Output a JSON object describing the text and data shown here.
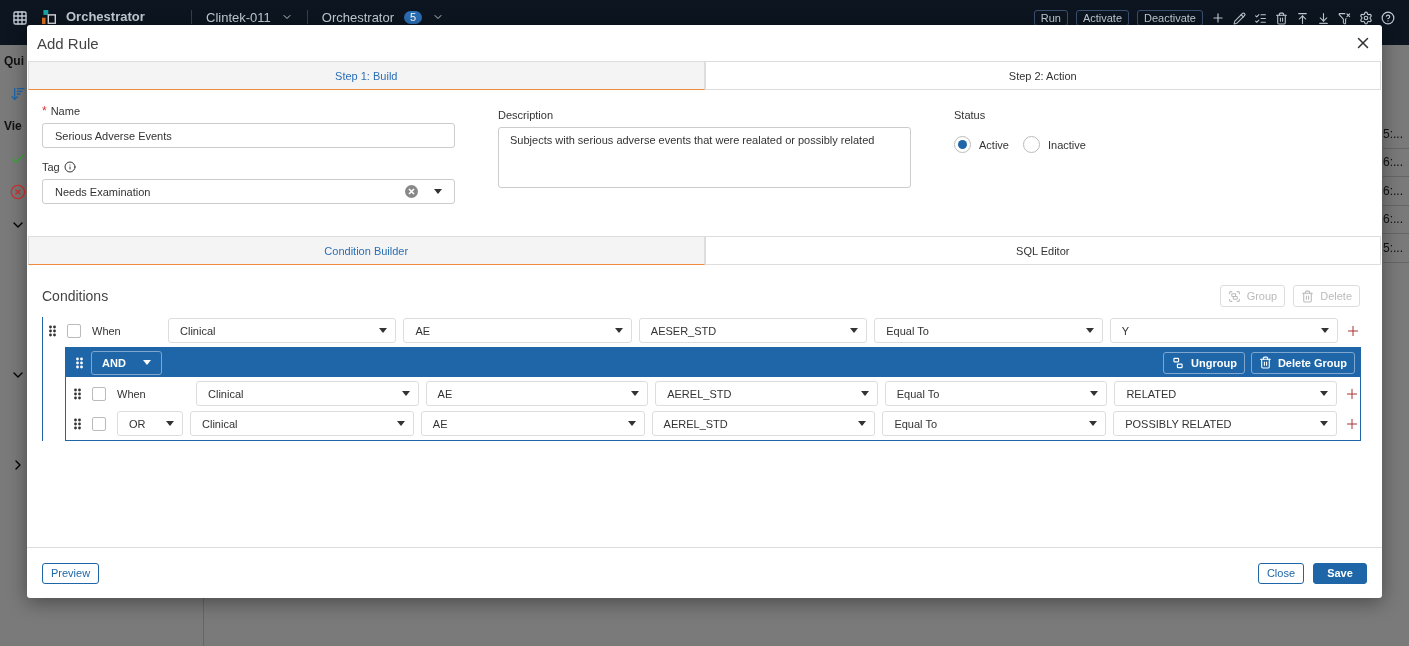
{
  "app": {
    "header": {
      "brand": "Orchestrator",
      "study": "Clintek-011",
      "module": "Orchestrator",
      "module_count": "5",
      "actions": [
        "Run",
        "Activate",
        "Deactivate"
      ]
    },
    "sidebar": {
      "headings": [
        "Qui",
        "Vie"
      ]
    },
    "column_cells": [
      "5:...",
      "6:...",
      "6:...",
      "6:...",
      "5:..."
    ]
  },
  "dialog": {
    "title": "Add Rule",
    "steps": [
      {
        "label": "Step 1: Build",
        "selected": true
      },
      {
        "label": "Step 2: Action",
        "selected": false
      }
    ],
    "name": {
      "label": "Name",
      "required_mark": "*",
      "value": "Serious Adverse Events"
    },
    "tag": {
      "label": "Tag",
      "value": "Needs Examination"
    },
    "description": {
      "label": "Description",
      "value": "Subjects with serious adverse events that were realated or possibly related"
    },
    "status": {
      "label": "Status",
      "options": [
        {
          "label": "Active",
          "selected": true
        },
        {
          "label": "Inactive",
          "selected": false
        }
      ]
    },
    "editor_tabs": [
      {
        "label": "Condition Builder",
        "selected": true
      },
      {
        "label": "SQL Editor",
        "selected": false
      }
    ],
    "conditions": {
      "title": "Conditions",
      "actions": [
        {
          "label": "Group",
          "disabled": true
        },
        {
          "label": "Delete",
          "disabled": true
        }
      ],
      "items": [
        {
          "kind": "condition",
          "checked": false,
          "connector": {
            "kind": "label",
            "text": "When"
          },
          "fields": [
            "Clinical",
            "AE",
            "AESER_STD",
            "Equal To",
            "Y"
          ]
        },
        {
          "kind": "group",
          "operator": "AND",
          "actions": [
            "Ungroup",
            "Delete Group"
          ],
          "children": [
            {
              "kind": "condition",
              "checked": false,
              "connector": {
                "kind": "label",
                "text": "When"
              },
              "fields": [
                "Clinical",
                "AE",
                "AEREL_STD",
                "Equal To",
                "RELATED"
              ]
            },
            {
              "kind": "condition",
              "checked": false,
              "connector": {
                "kind": "select",
                "text": "OR"
              },
              "fields": [
                "Clinical",
                "AE",
                "AEREL_STD",
                "Equal To",
                "POSSIBLY RELATED"
              ]
            }
          ]
        }
      ]
    },
    "footer": {
      "left": "Preview",
      "close": "Close",
      "save": "Save"
    }
  }
}
